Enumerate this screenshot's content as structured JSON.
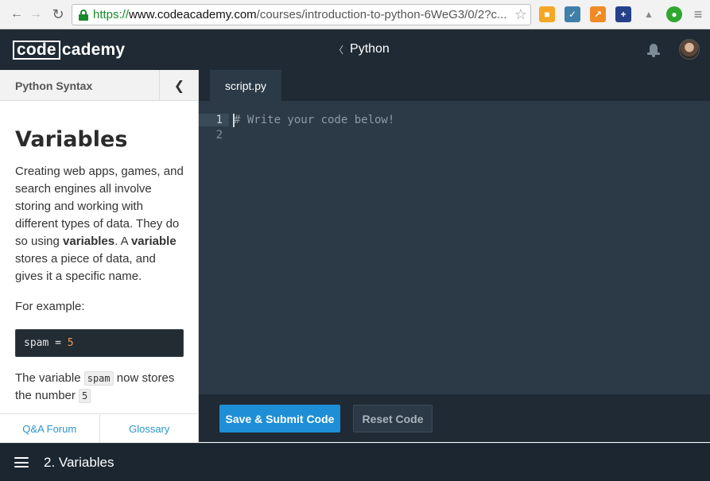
{
  "browser": {
    "back_icon": "arrow-left-icon",
    "forward_icon": "arrow-right-icon",
    "reload_icon": "reload-icon",
    "url_scheme": "https://",
    "url_domain": "www.codeacademy.com",
    "url_path": "/courses/introduction-to-python-6WeG3/0/2?c..."
  },
  "header": {
    "logo_code": "code",
    "logo_academy": "cademy",
    "course_title": "Python"
  },
  "sidebar": {
    "section_title": "Python Syntax",
    "heading": "Variables",
    "para1_a": "Creating web apps, games, and search engines all involve storing and working with different types of data. They do so using ",
    "para1_bold1": "variables",
    "para1_b": ". A ",
    "para1_bold2": "variable",
    "para1_c": " stores a piece of data, and gives it a specific name.",
    "example_label": "For example:",
    "code_var": "spam",
    "code_op": " = ",
    "code_num": "5",
    "after_a": "The variable ",
    "after_code": "spam",
    "after_b": " now stores the number ",
    "after_code2": "5",
    "footer_qa": "Q&A Forum",
    "footer_glossary": "Glossary"
  },
  "editor": {
    "tab_label": "script.py",
    "lines": [
      {
        "num": "1",
        "text": "# Write your code below!"
      },
      {
        "num": "2",
        "text": ""
      }
    ],
    "submit_label": "Save & Submit Code",
    "reset_label": "Reset Code"
  },
  "footer": {
    "lesson_label": "2. Variables"
  },
  "colors": {
    "accent": "#1e8fd6",
    "dark_bg": "#1f2a34",
    "editor_bg": "#2b3a46"
  }
}
